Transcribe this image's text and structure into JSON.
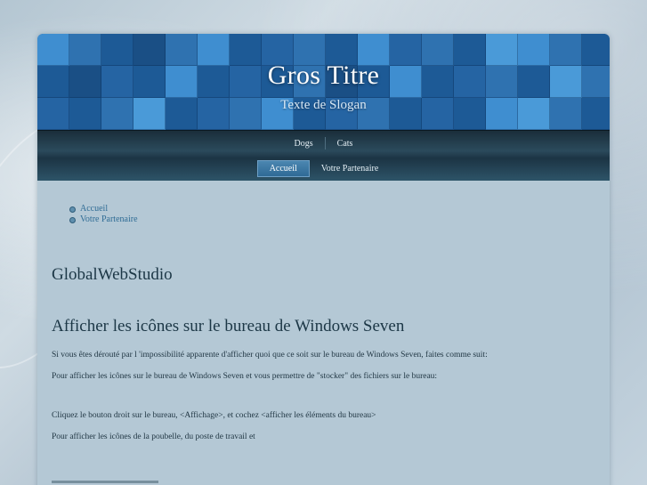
{
  "header": {
    "title": "Gros Titre",
    "slogan": "Texte de Slogan"
  },
  "nav": {
    "top": [
      {
        "label": "Dogs"
      },
      {
        "label": "Cats"
      }
    ],
    "bottom": [
      {
        "label": "Accueil",
        "active": true
      },
      {
        "label": "Votre Partenaire",
        "active": false
      }
    ]
  },
  "submenu": [
    {
      "label": "Accueil"
    },
    {
      "label": "Votre Partenaire"
    }
  ],
  "content": {
    "site_name": "GlobalWebStudio",
    "article_title": "Afficher les icônes sur le bureau de Windows Seven",
    "paragraphs": [
      "Si vous êtes dérouté par l 'impossibilité apparente d'afficher quoi que ce soit sur le bureau de Windows Seven, faites comme suit:",
      "Pour afficher les icônes sur le bureau de Windows Seven et vous permettre de \"stocker\" des fichiers sur le bureau:",
      "Cliquez le bouton droit sur le bureau,  <Affichage>, et cochez <afficher les éléments du bureau>",
      " Pour afficher les icônes de la poubelle, du poste de travail et"
    ]
  },
  "colors": {
    "header_blue": "#1d5a96",
    "tile_light": "#3f8ed0",
    "tile_mid": "#2f72b0",
    "nav_dark": "#1a2e3a",
    "active_tab": "#3f7ba6",
    "link": "#2f6c95"
  },
  "icons": {
    "submenu_bullet": "circle-bullet-icon"
  }
}
